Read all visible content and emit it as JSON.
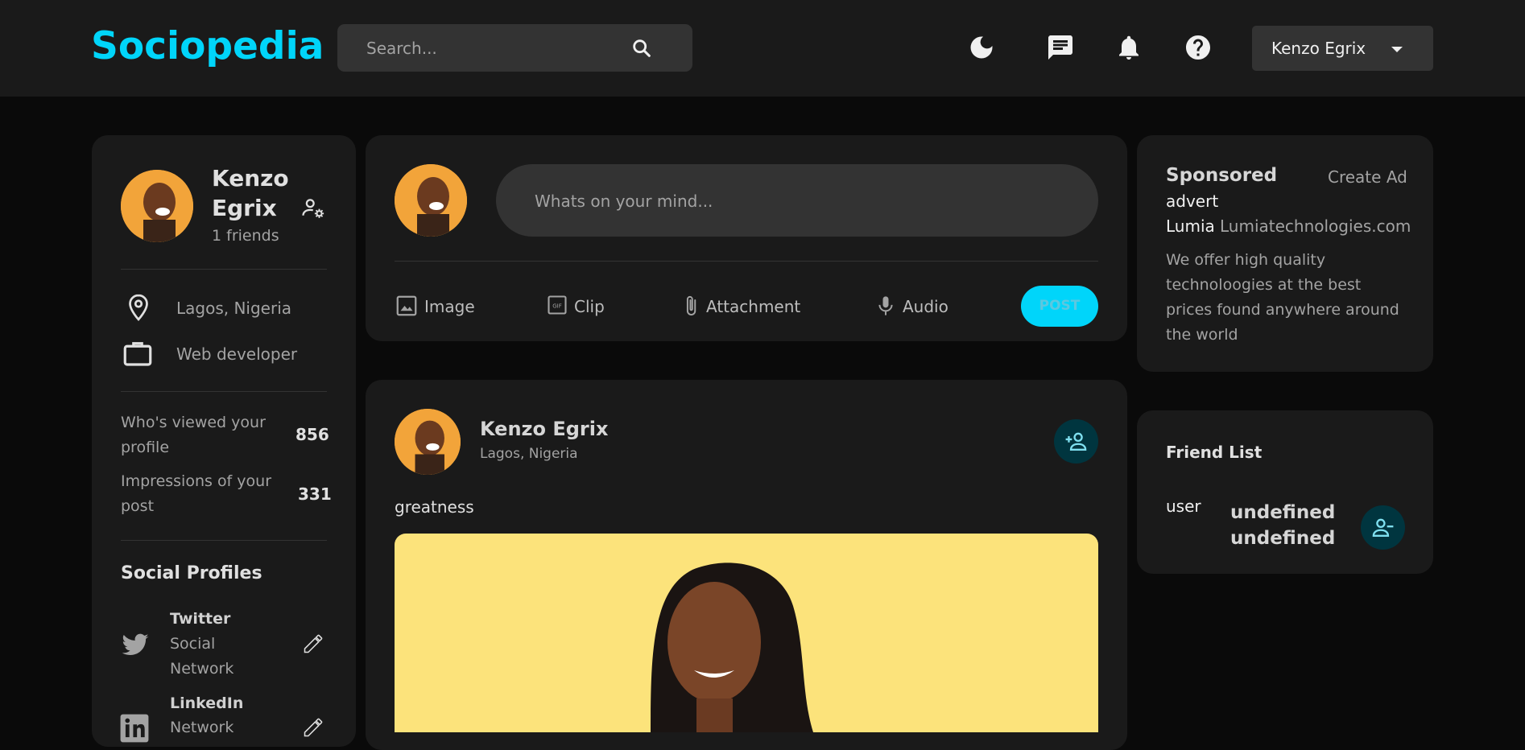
{
  "app": {
    "logo": "Sociopedia"
  },
  "search": {
    "placeholder": "Search..."
  },
  "nav": {
    "user_name": "Kenzo Egrix"
  },
  "profile": {
    "name_line1": "Kenzo",
    "name_line2": "Egrix",
    "friends": "1 friends",
    "location": "Lagos, Nigeria",
    "occupation": "Web developer",
    "viewed_label_1": "Who's viewed your",
    "viewed_label_2": "profile",
    "viewed_value": "856",
    "impressions_label_1": "Impressions of your",
    "impressions_label_2": "post",
    "impressions_value": "331",
    "social_title": "Social Profiles",
    "twitter_name": "Twitter",
    "twitter_type_1": "Social",
    "twitter_type_2": "Network",
    "linkedin_name": "LinkedIn",
    "linkedin_type": "Network"
  },
  "composer": {
    "placeholder": "Whats on your mind...",
    "image": "Image",
    "clip": "Clip",
    "attachment": "Attachment",
    "audio": "Audio",
    "post": "POST"
  },
  "post": {
    "name": "Kenzo Egrix",
    "location": "Lagos, Nigeria",
    "text": "greatness"
  },
  "sponsored": {
    "title": "Sponsored",
    "create_ad": "Create Ad",
    "advert": "advert",
    "brand": "Lumia",
    "site": "Lumiatechnologies.com",
    "desc_1": "We offer high quality",
    "desc_2": "technoloogies at the best",
    "desc_3": "prices found anywhere around",
    "desc_4": "the world"
  },
  "friends": {
    "title": "Friend List",
    "user_label": "user",
    "friend_name_1": "undefined",
    "friend_name_2": "undefined"
  },
  "colors": {
    "accent": "#00d5fa",
    "card": "#1a1a1a",
    "bg": "#0a0a0a"
  }
}
